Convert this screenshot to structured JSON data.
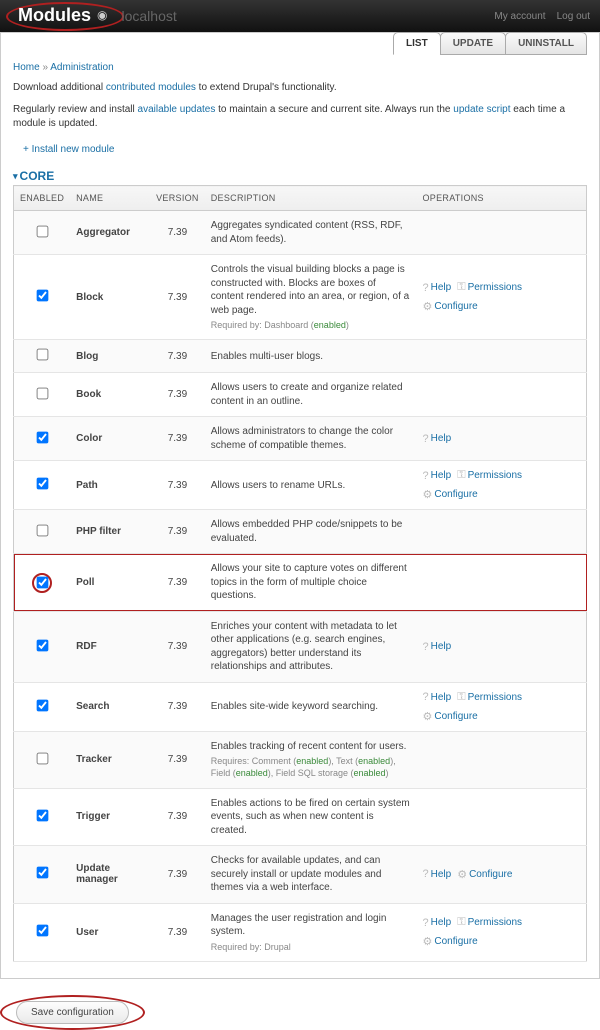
{
  "topbar": {
    "title": "Modules",
    "localhost": "localhost",
    "my_account": "My account",
    "log_out": "Log out"
  },
  "tabs": [
    {
      "label": "LIST",
      "active": true
    },
    {
      "label": "UPDATE",
      "active": false
    },
    {
      "label": "UNINSTALL",
      "active": false
    }
  ],
  "breadcrumb": {
    "home": "Home",
    "sep": "»",
    "admin": "Administration"
  },
  "intro1_pre": "Download additional ",
  "intro1_link": "contributed modules",
  "intro1_post": " to extend Drupal's functionality.",
  "intro2_pre": "Regularly review and install ",
  "intro2_link": "available updates",
  "intro2_mid": " to maintain a secure and current site. Always run the ",
  "intro2_link2": "update script",
  "intro2_post": " each time a module is updated.",
  "install_new": "+ Install new module",
  "section_title": "CORE",
  "th": {
    "enabled": "ENABLED",
    "name": "NAME",
    "version": "VERSION",
    "desc": "DESCRIPTION",
    "ops": "OPERATIONS"
  },
  "ops_labels": {
    "help": "Help",
    "permissions": "Permissions",
    "configure": "Configure"
  },
  "save_button": "Save configuration",
  "modules": [
    {
      "enabled": false,
      "name": "Aggregator",
      "version": "7.39",
      "desc": "Aggregates syndicated content (RSS, RDF, and Atom feeds).",
      "ops": []
    },
    {
      "enabled": true,
      "name": "Block",
      "version": "7.39",
      "desc": "Controls the visual building blocks a page is constructed with. Blocks are boxes of content rendered into an area, or region, of a web page.",
      "req": "Required by: Dashboard (enabled)",
      "ops": [
        "help",
        "permissions",
        "configure"
      ]
    },
    {
      "enabled": false,
      "name": "Blog",
      "version": "7.39",
      "desc": "Enables multi-user blogs.",
      "ops": []
    },
    {
      "enabled": false,
      "name": "Book",
      "version": "7.39",
      "desc": "Allows users to create and organize related content in an outline.",
      "ops": []
    },
    {
      "enabled": true,
      "name": "Color",
      "version": "7.39",
      "desc": "Allows administrators to change the color scheme of compatible themes.",
      "ops": [
        "help"
      ]
    },
    {
      "enabled": true,
      "name": "Path",
      "version": "7.39",
      "desc": "Allows users to rename URLs.",
      "ops": [
        "help",
        "permissions",
        "configure"
      ]
    },
    {
      "enabled": false,
      "name": "PHP filter",
      "version": "7.39",
      "desc": "Allows embedded PHP code/snippets to be evaluated.",
      "ops": []
    },
    {
      "enabled": true,
      "highlight": true,
      "name": "Poll",
      "version": "7.39",
      "desc": "Allows your site to capture votes on different topics in the form of multiple choice questions.",
      "ops": []
    },
    {
      "enabled": true,
      "name": "RDF",
      "version": "7.39",
      "desc": "Enriches your content with metadata to let other applications (e.g. search engines, aggregators) better understand its relationships and attributes.",
      "ops": [
        "help"
      ]
    },
    {
      "enabled": true,
      "name": "Search",
      "version": "7.39",
      "desc": "Enables site-wide keyword searching.",
      "ops": [
        "help",
        "permissions",
        "configure"
      ]
    },
    {
      "enabled": false,
      "name": "Tracker",
      "version": "7.39",
      "desc": "Enables tracking of recent content for users.",
      "req": "Requires: Comment (enabled), Text (enabled), Field (enabled), Field SQL storage (enabled)",
      "ops": []
    },
    {
      "enabled": true,
      "name": "Trigger",
      "version": "7.39",
      "desc": "Enables actions to be fired on certain system events, such as when new content is created.",
      "ops": []
    },
    {
      "enabled": true,
      "name": "Update manager",
      "version": "7.39",
      "desc": "Checks for available updates, and can securely install or update modules and themes via a web interface.",
      "ops": [
        "help",
        "configure"
      ]
    },
    {
      "enabled": true,
      "name": "User",
      "version": "7.39",
      "desc": "Manages the user registration and login system.",
      "req": "Required by: Drupal",
      "ops": [
        "help",
        "permissions",
        "configure"
      ]
    }
  ]
}
